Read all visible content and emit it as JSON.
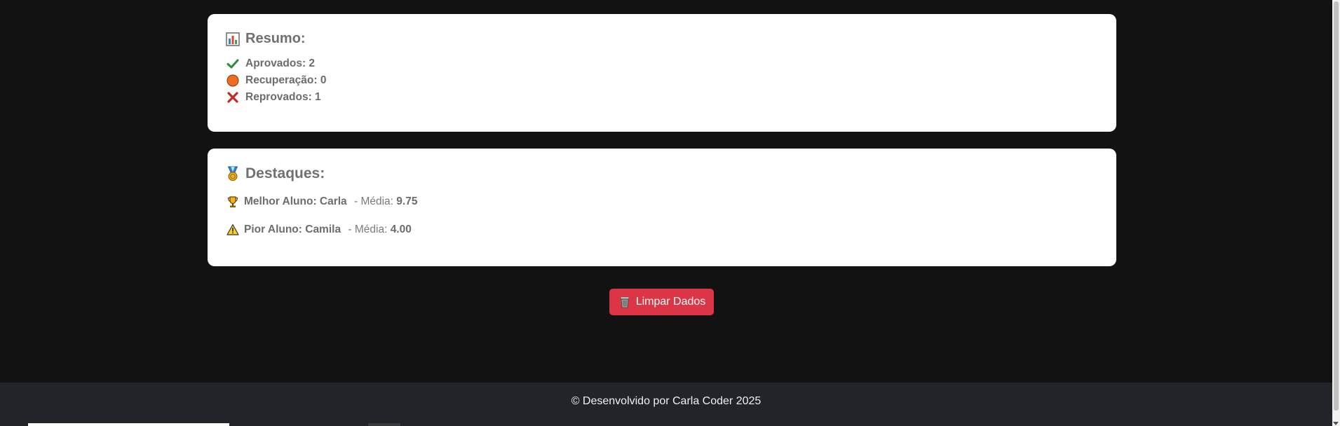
{
  "summary": {
    "title": "Resumo:",
    "title_icon": "bar-chart-icon",
    "approved_label": "Aprovados: 2",
    "recovery_label": "Recuperação: 0",
    "failed_label": "Reprovados: 1"
  },
  "highlights": {
    "title": "Destaques:",
    "title_icon": "medal-icon",
    "best_label": "Melhor Aluno: Carla",
    "best_sep": " - Média: ",
    "best_avg": "9.75",
    "worst_label": "Pior Aluno: Camila",
    "worst_sep": " - Média: ",
    "worst_avg": "4.00"
  },
  "actions": {
    "clear_label": "Limpar Dados",
    "clear_icon": "trash-icon"
  },
  "footer": {
    "text": "© Desenvolvido por Carla Coder 2025"
  },
  "colors": {
    "background": "#121212",
    "card": "#ffffff",
    "danger": "#dc3545",
    "footer": "#212529",
    "text": "#6c6c6c"
  }
}
